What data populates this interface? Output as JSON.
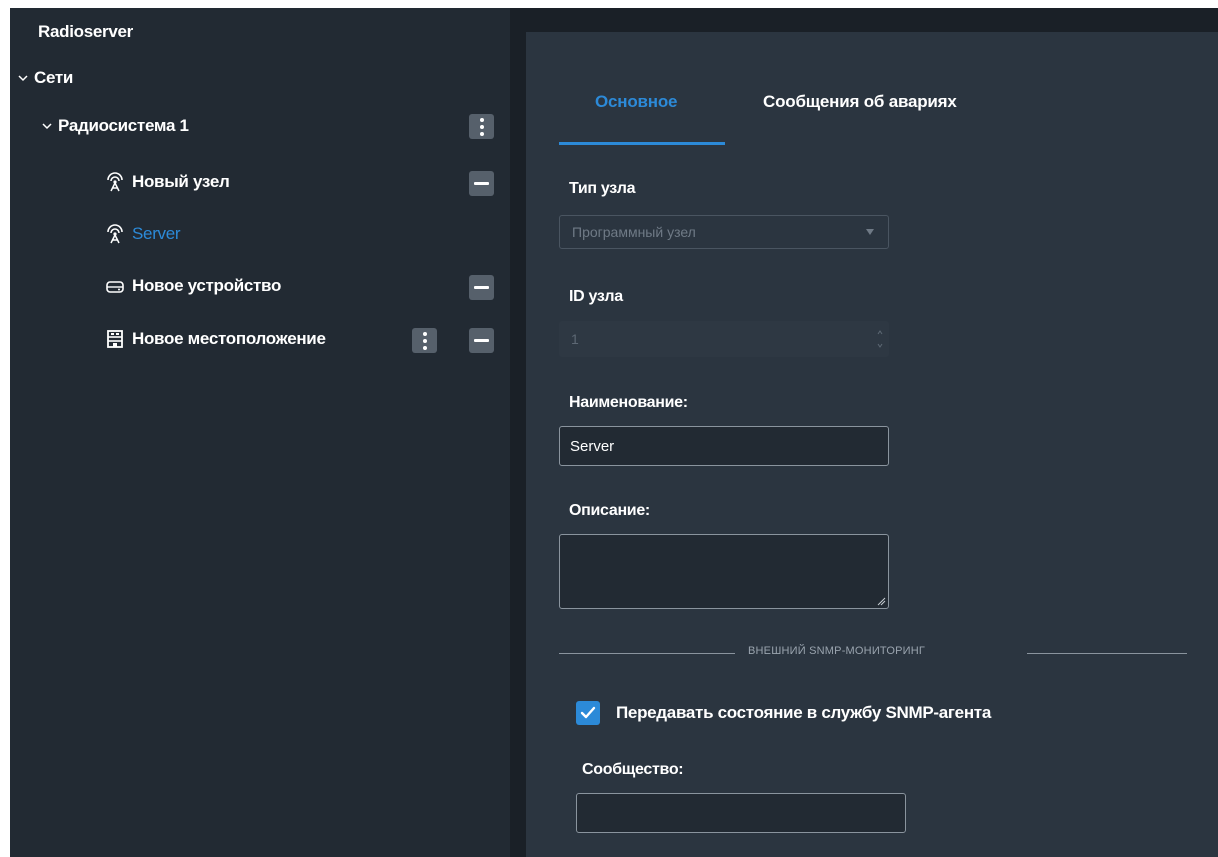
{
  "sidebar": {
    "app_title": "Radioserver",
    "tree": {
      "networks": {
        "label": "Сети"
      },
      "radiosystem": {
        "label": "Радиосистема 1"
      },
      "items": [
        {
          "label": "Новый узел",
          "icon": "antenna-icon"
        },
        {
          "label": "Server",
          "icon": "antenna-icon",
          "selected": true
        },
        {
          "label": "Новое устройство",
          "icon": "device-icon"
        },
        {
          "label": "Новое местоположение",
          "icon": "location-icon"
        }
      ]
    }
  },
  "tabs": [
    {
      "label": "Основное",
      "active": true
    },
    {
      "label": "Сообщения об авариях",
      "active": false
    }
  ],
  "form": {
    "node_type": {
      "label": "Тип узла",
      "value": "Программный узел"
    },
    "node_id": {
      "label": "ID узла",
      "value": "1"
    },
    "name": {
      "label": "Наименование:",
      "value": "Server"
    },
    "description": {
      "label": "Описание:",
      "value": ""
    },
    "snmp_section": {
      "title": "ВНЕШНИЙ SNMP-МОНИТОРИНГ",
      "send_state_label": "Передавать состояние в службу SNMP-агента",
      "send_state_checked": true,
      "community_label": "Сообщество:",
      "community_value": ""
    }
  },
  "colors": {
    "accent": "#2c8ad8",
    "background": "#222a33",
    "panel": "#2b3540"
  }
}
